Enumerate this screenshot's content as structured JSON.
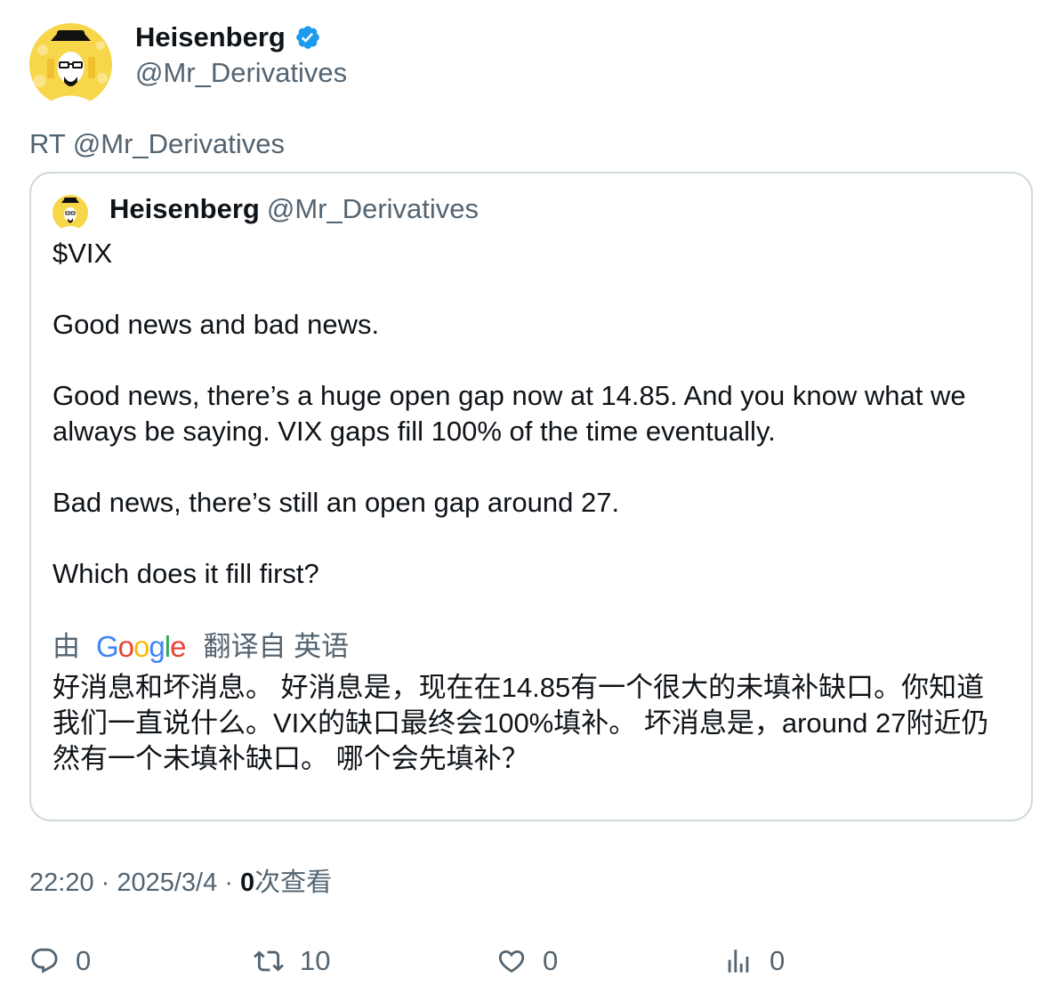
{
  "author": {
    "display_name": "Heisenberg",
    "handle": "@Mr_Derivatives",
    "avatar_icon": "heisenberg-avatar-icon",
    "verified_icon": "verified-badge-icon"
  },
  "retweet_text": "RT @Mr_Derivatives",
  "quoted_tweet": {
    "display_name": "Heisenberg",
    "handle": "@Mr_Derivatives",
    "paragraphs": [
      "$VIX",
      "Good news and bad news.",
      "Good news, there’s a huge open gap now at 14.85. And you know what we always be saying. VIX gaps fill 100% of the time eventually.",
      "Bad news, there’s still an open gap around 27.",
      "Which does it fill first?"
    ],
    "translation": {
      "prefix": "由",
      "provider": "Google",
      "suffix": "翻译自 英语",
      "text": "好消息和坏消息。 好消息是，现在在14.85有一个很大的未填补缺口。你知道我们一直说什么。VIX的缺口最终会100%填补。 坏消息是，around 27附近仍然有一个未填补缺口。 哪个会先填补？"
    }
  },
  "meta": {
    "time": "22:20",
    "date": "2025/3/4",
    "views_count": "0",
    "views_label": "次查看"
  },
  "actions": {
    "reply": {
      "icon": "reply-icon",
      "count": "0"
    },
    "retweet": {
      "icon": "retweet-icon",
      "count": "10"
    },
    "like": {
      "icon": "heart-icon",
      "count": "0"
    },
    "views": {
      "icon": "analytics-icon",
      "count": "0"
    }
  },
  "colors": {
    "verified": "#1d9bf0",
    "secondary_text": "#536471",
    "primary_text": "#0f1419",
    "border": "#cfd9de",
    "avatar_bg": "#f7d64a"
  }
}
